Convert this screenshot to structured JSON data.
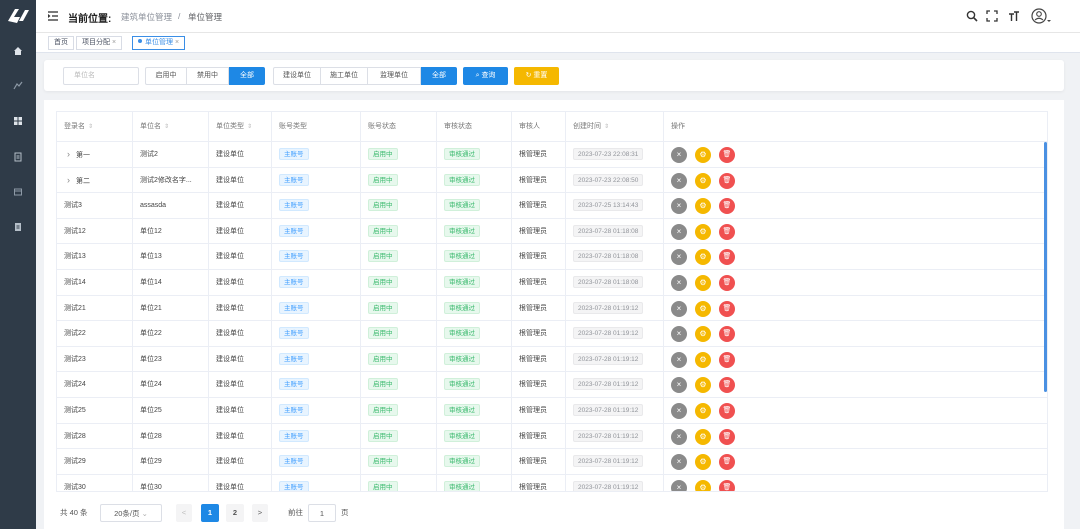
{
  "header": {
    "loc_title": "当前位置:",
    "crumb1": "建筑单位管理",
    "sep": "/",
    "crumb2": "单位管理"
  },
  "tags": [
    "首页",
    "项目分配",
    "单位管理"
  ],
  "filter": {
    "placeholder": "单位名",
    "status": [
      "启用中",
      "禁用中",
      "全部"
    ],
    "types": [
      "建设单位",
      "施工单位",
      "监理单位",
      "全部"
    ],
    "search": "查询",
    "reset": "重置"
  },
  "table": {
    "headers": [
      "登录名",
      "单位名",
      "单位类型",
      "账号类型",
      "账号状态",
      "审核状态",
      "审核人",
      "创建时间",
      "操作"
    ],
    "rows": [
      {
        "login": "第一",
        "unit": "测试2",
        "type": "建设单位",
        "acct": "主账号",
        "status": "启用中",
        "audit": "审核通过",
        "auditor": "根管理员",
        "time": "2023-07-23 22:08:31"
      },
      {
        "login": "第二",
        "unit": "测试2修改名字...",
        "type": "建设单位",
        "acct": "主账号",
        "status": "启用中",
        "audit": "审核通过",
        "auditor": "根管理员",
        "time": "2023-07-23 22:08:50"
      },
      {
        "login": "测试3",
        "unit": "assasda",
        "type": "建设单位",
        "acct": "主账号",
        "status": "启用中",
        "audit": "审核通过",
        "auditor": "根管理员",
        "time": "2023-07-25 13:14:43"
      },
      {
        "login": "测试12",
        "unit": "单位12",
        "type": "建设单位",
        "acct": "主账号",
        "status": "启用中",
        "audit": "审核通过",
        "auditor": "根管理员",
        "time": "2023-07-28 01:18:08"
      },
      {
        "login": "测试13",
        "unit": "单位13",
        "type": "建设单位",
        "acct": "主账号",
        "status": "启用中",
        "audit": "审核通过",
        "auditor": "根管理员",
        "time": "2023-07-28 01:18:08"
      },
      {
        "login": "测试14",
        "unit": "单位14",
        "type": "建设单位",
        "acct": "主账号",
        "status": "启用中",
        "audit": "审核通过",
        "auditor": "根管理员",
        "time": "2023-07-28 01:18:08"
      },
      {
        "login": "测试21",
        "unit": "单位21",
        "type": "建设单位",
        "acct": "主账号",
        "status": "启用中",
        "audit": "审核通过",
        "auditor": "根管理员",
        "time": "2023-07-28 01:19:12"
      },
      {
        "login": "测试22",
        "unit": "单位22",
        "type": "建设单位",
        "acct": "主账号",
        "status": "启用中",
        "audit": "审核通过",
        "auditor": "根管理员",
        "time": "2023-07-28 01:19:12"
      },
      {
        "login": "测试23",
        "unit": "单位23",
        "type": "建设单位",
        "acct": "主账号",
        "status": "启用中",
        "audit": "审核通过",
        "auditor": "根管理员",
        "time": "2023-07-28 01:19:12"
      },
      {
        "login": "测试24",
        "unit": "单位24",
        "type": "建设单位",
        "acct": "主账号",
        "status": "启用中",
        "audit": "审核通过",
        "auditor": "根管理员",
        "time": "2023-07-28 01:19:12"
      },
      {
        "login": "测试25",
        "unit": "单位25",
        "type": "建设单位",
        "acct": "主账号",
        "status": "启用中",
        "audit": "审核通过",
        "auditor": "根管理员",
        "time": "2023-07-28 01:19:12"
      },
      {
        "login": "测试28",
        "unit": "单位28",
        "type": "建设单位",
        "acct": "主账号",
        "status": "启用中",
        "audit": "审核通过",
        "auditor": "根管理员",
        "time": "2023-07-28 01:19:12"
      },
      {
        "login": "测试29",
        "unit": "单位29",
        "type": "建设单位",
        "acct": "主账号",
        "status": "启用中",
        "audit": "审核通过",
        "auditor": "根管理员",
        "time": "2023-07-28 01:19:12"
      },
      {
        "login": "测试30",
        "unit": "单位30",
        "type": "建设单位",
        "acct": "主账号",
        "status": "启用中",
        "audit": "审核通过",
        "auditor": "根管理员",
        "time": "2023-07-28 01:19:12"
      }
    ]
  },
  "pagination": {
    "total": "共 40 条",
    "page_size": "20条/页",
    "prev": "<",
    "pages": [
      "1",
      "2"
    ],
    "next": ">",
    "goto_label": "前往",
    "goto_value": "1",
    "goto_unit": "页"
  },
  "colors": {
    "sidebar": "#2f3b48",
    "primary": "#1e88e5",
    "search": "#1e88e5",
    "reset": "#f5b800",
    "delete": "#f05050"
  }
}
